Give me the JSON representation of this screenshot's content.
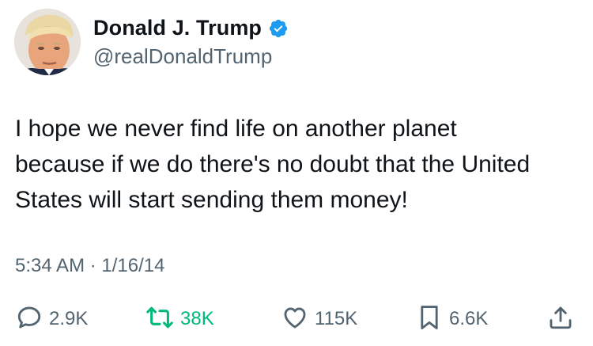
{
  "author": {
    "display_name": "Donald J. Trump",
    "handle": "@realDonaldTrump",
    "verified": true,
    "verified_icon": "verified-badge-icon",
    "verified_color": "#1d9bf0"
  },
  "tweet": {
    "text": "I hope we never find life on another planet\nbecause if we do there's no doubt that the United\nStates will start sending them money!",
    "timestamp": "5:34 AM · 1/16/14"
  },
  "actions": {
    "reply": {
      "icon": "reply-icon",
      "count": "2.9K"
    },
    "retweet": {
      "icon": "retweet-icon",
      "count": "38K",
      "color": "#00ba7c"
    },
    "like": {
      "icon": "heart-icon",
      "count": "115K"
    },
    "bookmark": {
      "icon": "bookmark-icon",
      "count": "6.6K"
    },
    "share": {
      "icon": "share-icon"
    }
  },
  "colors": {
    "text_primary": "#0f1419",
    "text_secondary": "#536471",
    "icon": "#536471"
  }
}
